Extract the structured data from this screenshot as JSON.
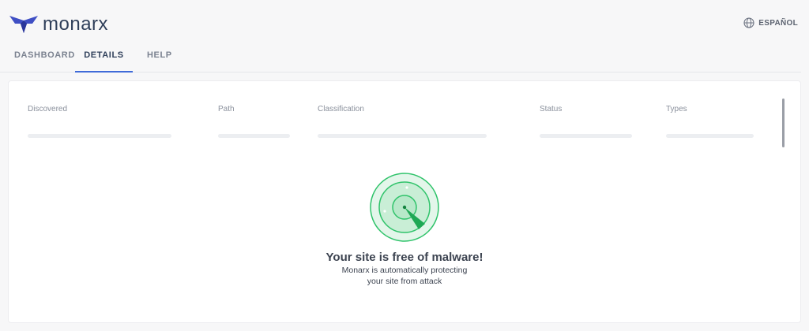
{
  "header": {
    "brand": "monarx",
    "language_label": "ESPAÑOL"
  },
  "tabs": [
    {
      "label": "DASHBOARD",
      "active": false
    },
    {
      "label": "DETAILS",
      "active": true
    },
    {
      "label": "HELP",
      "active": false
    }
  ],
  "table": {
    "columns": [
      "Discovered",
      "Path",
      "Classification",
      "Status",
      "Types"
    ]
  },
  "empty_state": {
    "title": "Your site is free of malware!",
    "line1": "Monarx is automatically protecting",
    "line2": "your site from attack"
  },
  "colors": {
    "brand": "#3f4fc4",
    "tab_active_underline": "#3f6ad8",
    "radar_green": "#1db954"
  },
  "icons": {
    "logo": "butterfly-logo-icon",
    "language": "globe-icon",
    "radar": "radar-icon"
  }
}
